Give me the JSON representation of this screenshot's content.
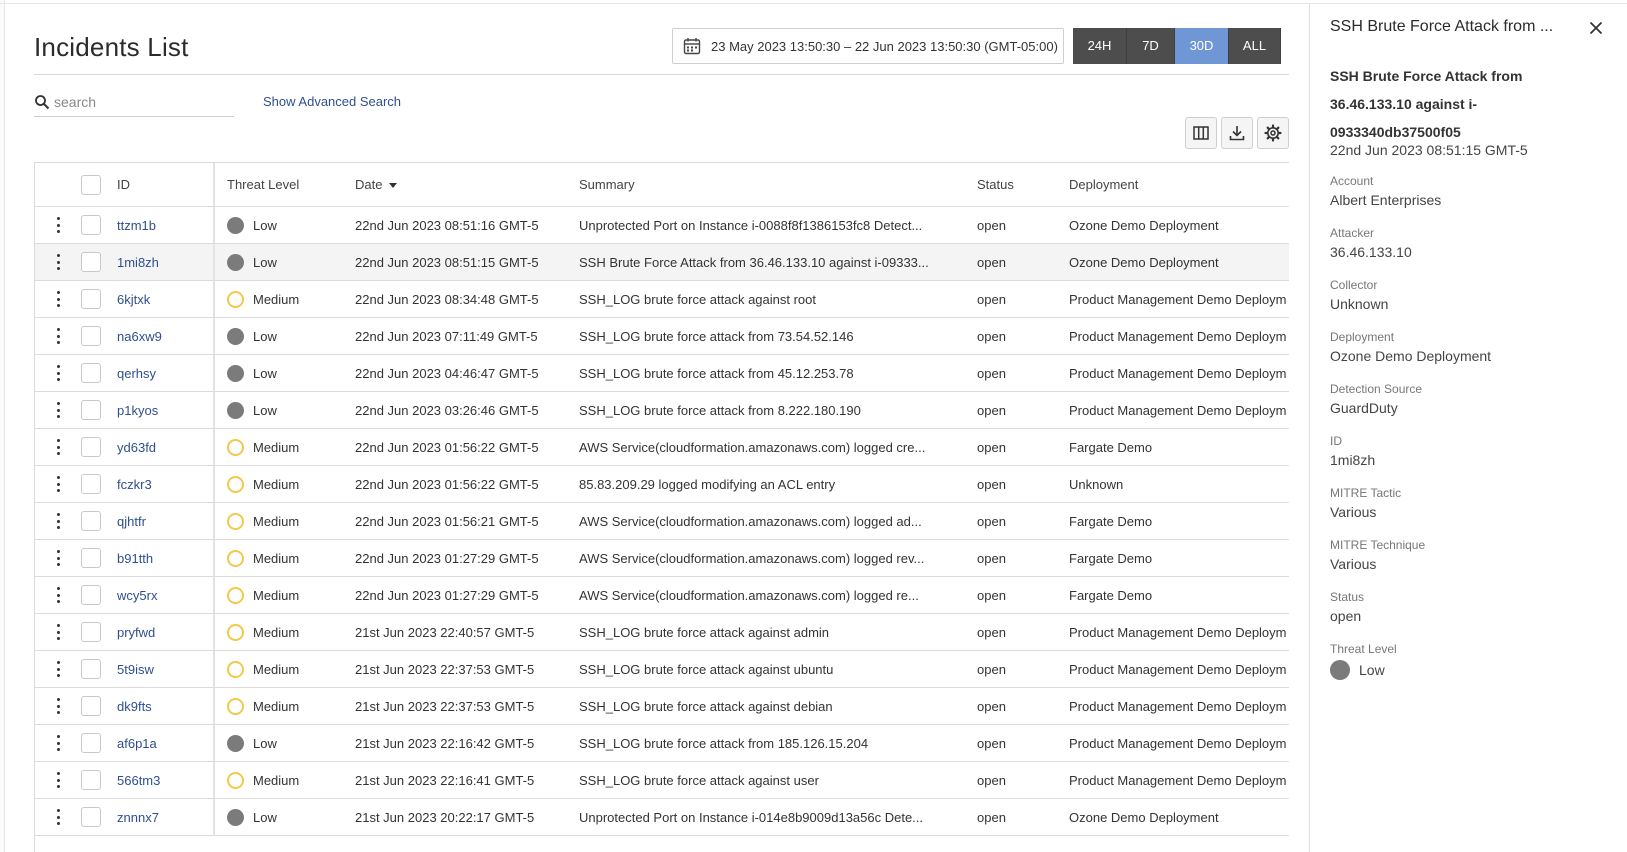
{
  "header": {
    "title": "Incidents List",
    "date_range": "23 May 2023 13:50:30 – 22 Jun 2023 13:50:30 (GMT-05:00)",
    "ranges": [
      "24H",
      "7D",
      "30D",
      "ALL"
    ],
    "active_range": "30D"
  },
  "search": {
    "placeholder": "search",
    "advanced_label": "Show Advanced Search"
  },
  "table": {
    "columns": {
      "id": "ID",
      "threat": "Threat Level",
      "date": "Date",
      "summary": "Summary",
      "status": "Status",
      "deployment": "Deployment"
    },
    "rows": [
      {
        "id": "ttzm1b",
        "threat": "Low",
        "date": "22nd Jun 2023 08:51:16 GMT-5",
        "summary": "Unprotected Port on Instance i-0088f8f1386153fc8 Detect...",
        "status": "open",
        "deployment": "Ozone Demo Deployment"
      },
      {
        "id": "1mi8zh",
        "threat": "Low",
        "date": "22nd Jun 2023 08:51:15 GMT-5",
        "summary": "SSH Brute Force Attack from 36.46.133.10 against i-09333...",
        "status": "open",
        "deployment": "Ozone Demo Deployment"
      },
      {
        "id": "6kjtxk",
        "threat": "Medium",
        "date": "22nd Jun 2023 08:34:48 GMT-5",
        "summary": "SSH_LOG brute force attack against root",
        "status": "open",
        "deployment": "Product Management Demo Deploym"
      },
      {
        "id": "na6xw9",
        "threat": "Low",
        "date": "22nd Jun 2023 07:11:49 GMT-5",
        "summary": "SSH_LOG brute force attack from 73.54.52.146",
        "status": "open",
        "deployment": "Product Management Demo Deploym"
      },
      {
        "id": "qerhsy",
        "threat": "Low",
        "date": "22nd Jun 2023 04:46:47 GMT-5",
        "summary": "SSH_LOG brute force attack from 45.12.253.78",
        "status": "open",
        "deployment": "Product Management Demo Deploym"
      },
      {
        "id": "p1kyos",
        "threat": "Low",
        "date": "22nd Jun 2023 03:26:46 GMT-5",
        "summary": "SSH_LOG brute force attack from 8.222.180.190",
        "status": "open",
        "deployment": "Product Management Demo Deploym"
      },
      {
        "id": "yd63fd",
        "threat": "Medium",
        "date": "22nd Jun 2023 01:56:22 GMT-5",
        "summary": "AWS Service(cloudformation.amazonaws.com) logged cre...",
        "status": "open",
        "deployment": "Fargate Demo"
      },
      {
        "id": "fczkr3",
        "threat": "Medium",
        "date": "22nd Jun 2023 01:56:22 GMT-5",
        "summary": "85.83.209.29 logged modifying an ACL entry",
        "status": "open",
        "deployment": "Unknown"
      },
      {
        "id": "qjhtfr",
        "threat": "Medium",
        "date": "22nd Jun 2023 01:56:21 GMT-5",
        "summary": "AWS Service(cloudformation.amazonaws.com) logged ad...",
        "status": "open",
        "deployment": "Fargate Demo"
      },
      {
        "id": "b91tth",
        "threat": "Medium",
        "date": "22nd Jun 2023 01:27:29 GMT-5",
        "summary": "AWS Service(cloudformation.amazonaws.com) logged rev...",
        "status": "open",
        "deployment": "Fargate Demo"
      },
      {
        "id": "wcy5rx",
        "threat": "Medium",
        "date": "22nd Jun 2023 01:27:29 GMT-5",
        "summary": "AWS Service(cloudformation.amazonaws.com) logged re...",
        "status": "open",
        "deployment": "Fargate Demo"
      },
      {
        "id": "pryfwd",
        "threat": "Medium",
        "date": "21st Jun 2023 22:40:57 GMT-5",
        "summary": "SSH_LOG brute force attack against admin",
        "status": "open",
        "deployment": "Product Management Demo Deploym"
      },
      {
        "id": "5t9isw",
        "threat": "Medium",
        "date": "21st Jun 2023 22:37:53 GMT-5",
        "summary": "SSH_LOG brute force attack against ubuntu",
        "status": "open",
        "deployment": "Product Management Demo Deploym"
      },
      {
        "id": "dk9fts",
        "threat": "Medium",
        "date": "21st Jun 2023 22:37:53 GMT-5",
        "summary": "SSH_LOG brute force attack against debian",
        "status": "open",
        "deployment": "Product Management Demo Deploym"
      },
      {
        "id": "af6p1a",
        "threat": "Low",
        "date": "21st Jun 2023 22:16:42 GMT-5",
        "summary": "SSH_LOG brute force attack from 185.126.15.204",
        "status": "open",
        "deployment": "Product Management Demo Deploym"
      },
      {
        "id": "566tm3",
        "threat": "Medium",
        "date": "21st Jun 2023 22:16:41 GMT-5",
        "summary": "SSH_LOG brute force attack against user",
        "status": "open",
        "deployment": "Product Management Demo Deploym"
      },
      {
        "id": "znnnx7",
        "threat": "Low",
        "date": "21st Jun 2023 20:22:17 GMT-5",
        "summary": "Unprotected Port on Instance i-014e8b9009d13a56c Dete...",
        "status": "open",
        "deployment": "Ozone Demo Deployment"
      }
    ],
    "selected_row": 1
  },
  "detail": {
    "header": "SSH Brute Force Attack from ...",
    "title": "SSH Brute Force Attack from 36.46.133.10 against i-0933340db37500f05",
    "timestamp": "22nd Jun 2023 08:51:15 GMT-5",
    "fields": [
      {
        "label": "Account",
        "value": "Albert Enterprises"
      },
      {
        "label": "Attacker",
        "value": "36.46.133.10"
      },
      {
        "label": "Collector",
        "value": "Unknown"
      },
      {
        "label": "Deployment",
        "value": "Ozone Demo Deployment"
      },
      {
        "label": "Detection Source",
        "value": "GuardDuty"
      },
      {
        "label": "ID",
        "value": "1mi8zh"
      },
      {
        "label": "MITRE Tactic",
        "value": "Various"
      },
      {
        "label": "MITRE Technique",
        "value": "Various"
      },
      {
        "label": "Status",
        "value": "open"
      },
      {
        "label": "Threat Level",
        "value": "Low"
      }
    ]
  },
  "colors": {
    "low": "#7b7b7b",
    "medium": "#f2c94c",
    "active_range": "#6f97d6",
    "range_button": "#4d4d4d",
    "link": "#2f4f8f"
  },
  "icons": [
    "calendar-icon",
    "search-icon",
    "columns-icon",
    "download-icon",
    "settings-icon",
    "close-icon",
    "kebab-menu-icon",
    "sort-desc-icon"
  ]
}
